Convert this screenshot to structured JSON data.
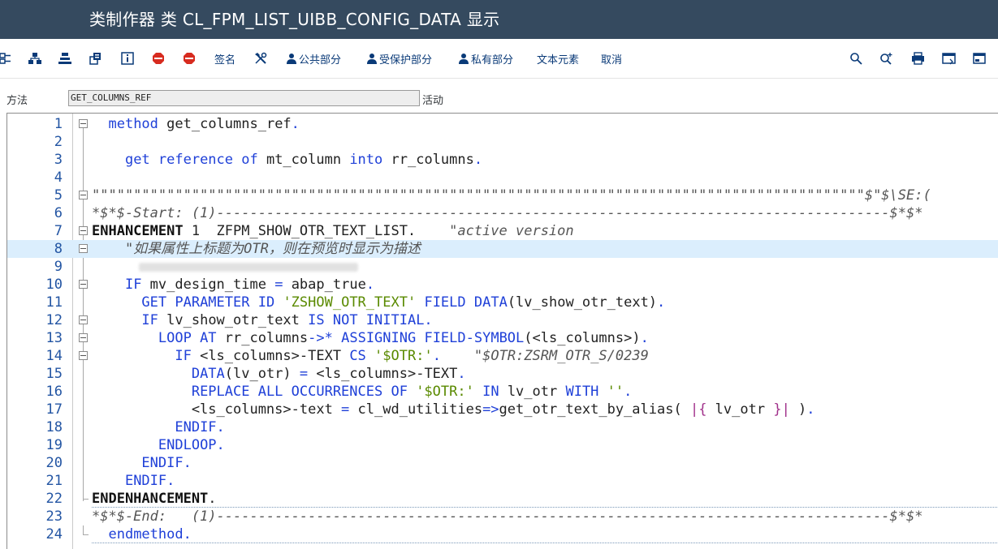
{
  "window": {
    "title": "类制作器 类 CL_FPM_LIST_UIBB_CONFIG_DATA 显示"
  },
  "toolbar": {
    "signature_label": "签名",
    "public_section_label": "公共部分",
    "protected_section_label": "受保护部分",
    "private_section_label": "私有部分",
    "text_elements_label": "文本元素",
    "cancel_label": "取消"
  },
  "method_field": {
    "label": "方法",
    "value": "GET_COLUMNS_REF",
    "status": "活动"
  },
  "editor": {
    "line_numbers": [
      "1",
      "2",
      "3",
      "4",
      "5",
      "6",
      "7",
      "8",
      "9",
      "10",
      "11",
      "12",
      "13",
      "14",
      "15",
      "16",
      "17",
      "18",
      "19",
      "20",
      "21",
      "22",
      "23",
      "24"
    ],
    "lines": [
      {
        "n": "1",
        "t": "  method get_columns_ref."
      },
      {
        "n": "2",
        "t": ""
      },
      {
        "n": "3",
        "t": "    get reference of mt_column into rr_columns."
      },
      {
        "n": "4",
        "t": ""
      },
      {
        "n": "5",
        "t": "\"\"\"\"\"\"\"\"\"\"\"\"\"\"\"\"\"\"\"\"\"\"\"\"\"\"\"\"\"\"\"\"\"\"\"\"\"\"\"\"\"\"\"\"\"\"\"\"\"\"\"\"\"\"\"\"\"\"\"\"\"\"\"\"\"\"\"\"\"\"\"\"\"\"\"\"\"\"\"\"\"\"\"\"\"\"\"\"\"\"\"\"\"$\"$\\SE:("
      },
      {
        "n": "6",
        "t": "*$*$-Start: (1)---------------------------------------------------------------------------------$*$*"
      },
      {
        "n": "7",
        "t": "ENHANCEMENT 1  ZFPM_SHOW_OTR_TEXT_LIST.    \"active version"
      },
      {
        "n": "8",
        "t": "    \"如果属性上标题为OTR，则在预览时显示为描述"
      },
      {
        "n": "9",
        "t": ""
      },
      {
        "n": "10",
        "t": "    IF mv_design_time = abap_true."
      },
      {
        "n": "11",
        "t": "      GET PARAMETER ID 'ZSHOW_OTR_TEXT' FIELD DATA(lv_show_otr_text)."
      },
      {
        "n": "12",
        "t": "      IF lv_show_otr_text IS NOT INITIAL."
      },
      {
        "n": "13",
        "t": "        LOOP AT rr_columns->* ASSIGNING FIELD-SYMBOL(<ls_columns>)."
      },
      {
        "n": "14",
        "t": "          IF <ls_columns>-TEXT CS '$OTR:'.    \"$OTR:ZSRM_OTR_S/0239"
      },
      {
        "n": "15",
        "t": "            DATA(lv_otr) = <ls_columns>-TEXT."
      },
      {
        "n": "16",
        "t": "            REPLACE ALL OCCURRENCES OF '$OTR:' IN lv_otr WITH ''."
      },
      {
        "n": "17",
        "t": "            <ls_columns>-text = cl_wd_utilities=>get_otr_text_by_alias( |{ lv_otr }| )."
      },
      {
        "n": "18",
        "t": "          ENDIF."
      },
      {
        "n": "19",
        "t": "        ENDLOOP."
      },
      {
        "n": "20",
        "t": "      ENDIF."
      },
      {
        "n": "21",
        "t": "    ENDIF."
      },
      {
        "n": "22",
        "t": "ENDENHANCEMENT."
      },
      {
        "n": "23",
        "t": "*$*$-End:   (1)---------------------------------------------------------------------------------$*$*"
      },
      {
        "n": "24",
        "t": "  endmethod."
      }
    ]
  },
  "icons": [
    "display-object-list-icon",
    "hierarchy-icon",
    "stack-icon",
    "where-used-icon",
    "info-icon",
    "stop-icon",
    "stop-icon",
    "tools-icon",
    "person-icon",
    "search-icon",
    "search-plus-icon",
    "print-icon",
    "window-icon",
    "window-export-icon"
  ],
  "colors": {
    "title_bar": "#354a5f",
    "keyword": "#1f40d8",
    "string": "#5a8a00",
    "comment": "#555555",
    "current_line": "#dbeefd",
    "line_number": "#2355a3"
  }
}
